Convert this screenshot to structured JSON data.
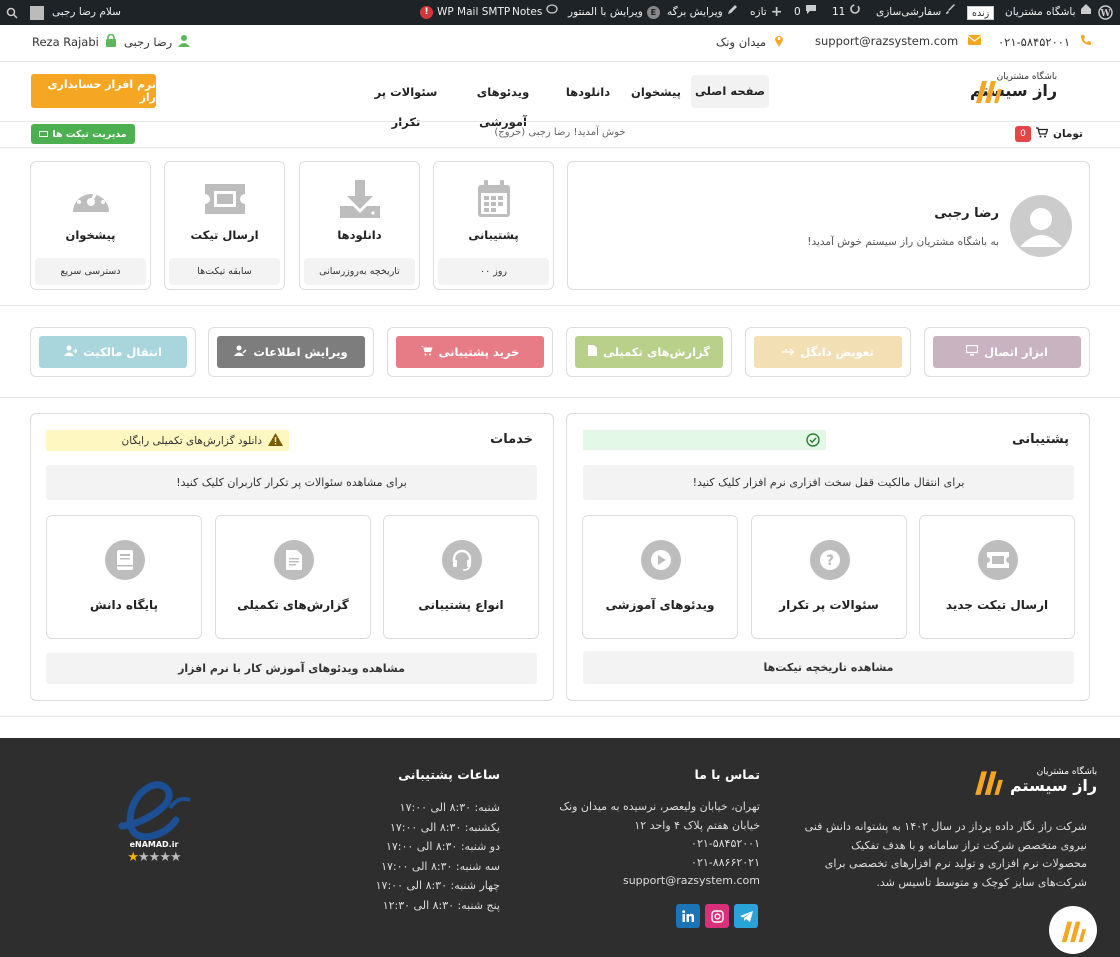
{
  "admin_bar": {
    "greeting": "سلام رضا رجبی",
    "site_name": "باشگاه مشتریان",
    "live_badge": "زنده",
    "customize": "سفارشی‌سازی",
    "updates_count": "11",
    "comments_count": "0",
    "new_label": "تازه",
    "edit_page": "ویرایش برگه",
    "edit_elementor": "ویرایش با المنتور",
    "notes": "Notes",
    "wp_mail_smtp": "WP Mail SMTP"
  },
  "top_info": {
    "phone": "۰۲۱-۵۸۴۵۲۰۰۱",
    "email": "support@razsystem.com",
    "location": "میدان ونک",
    "user_fa": "رضا رجبی",
    "user_en": "Reza Rajabi"
  },
  "brand": {
    "subtitle": "باشگاه مشتریان",
    "name": "راز سیستم"
  },
  "nav": {
    "items": [
      "صفحه اصلی",
      "پیشخوان",
      "دانلودها",
      "ویدئوهای آموزشی",
      "سئوالات پر تکرار"
    ],
    "cta": "نرم افزار حسابداری راز"
  },
  "subbar": {
    "cart_count": "0",
    "currency": "تومان",
    "welcome": "خوش آمدید! رضا رجبی (خروج)",
    "tickets_btn": "مدیریت تیکت ها"
  },
  "profile": {
    "name": "رضا رجبی",
    "message": "به باشگاه مشتریان راز سیستم خوش آمدید!"
  },
  "tiles": [
    {
      "title": "پشتیبانی",
      "sub": "۰۰ روز",
      "icon": "calendar-icon"
    },
    {
      "title": "دانلودها",
      "sub": "تاریخچه به‌روزرسانی",
      "icon": "download-icon"
    },
    {
      "title": "ارسال تیکت",
      "sub": "سابقه تیکت‌ها",
      "icon": "ticket-icon"
    },
    {
      "title": "پیشخوان",
      "sub": "دسترسی سریع",
      "icon": "dashboard-icon"
    }
  ],
  "quick_buttons": [
    {
      "label": "ابزار اتصال",
      "color": "#c9b3c0",
      "icon": "monitor-icon"
    },
    {
      "label": "تعویض دانگل",
      "color": "#f3dfb4",
      "icon": "usb-icon"
    },
    {
      "label": "گزارش‌های تکمیلی",
      "color": "#b9d08a",
      "icon": "file-icon"
    },
    {
      "label": "خرید پشتیبانی",
      "color": "#e87c86",
      "icon": "cart-icon"
    },
    {
      "label": "ویرایش اطلاعات",
      "color": "#7d7d7d",
      "icon": "user-edit-icon"
    },
    {
      "label": "انتقال مالکیت",
      "color": "#a9d6dc",
      "icon": "user-transfer-icon"
    }
  ],
  "support_panel": {
    "title": "پشتیبانی",
    "strip": "برای انتقال مالکیت قفل سخت افزاری نرم افزار کلیک کنید!",
    "cards": [
      {
        "label": "ارسال تیکت جدید",
        "icon": "ticket-icon"
      },
      {
        "label": "سئوالات پر تکرار",
        "icon": "question-icon"
      },
      {
        "label": "ویدئوهای آموزشی",
        "icon": "play-icon"
      }
    ],
    "footer": "مشاهده تاریخچه تیکت‌ها"
  },
  "services_panel": {
    "title": "خدمات",
    "notice": "دانلود گزارش‌های تکمیلی رایگان",
    "strip": "برای مشاهده سئوالات پر تکرار کاربران کلیک کنید!",
    "cards": [
      {
        "label": "انواع پشتیبانی",
        "icon": "headset-icon"
      },
      {
        "label": "گزارش‌های تکمیلی",
        "icon": "document-icon"
      },
      {
        "label": "پایگاه دانش",
        "icon": "book-icon"
      }
    ],
    "footer": "مشاهده ویدئوهای آموزش کار با نرم افزار"
  },
  "footer": {
    "brand_sub": "باشگاه مشتریان",
    "brand_name": "راز سیستم",
    "about": [
      "شرکت راز نگار داده پرداز در سال ۱۴۰۲ به پشتوانه دانش فنی",
      "نیروی متخصص شرکت تراز سامانه و با هدف تفکیک",
      "محصولات نرم افزاری و تولید نرم افزارهای تخصصی برای",
      "شرکت‌های سایز کوچک و متوسط تاسیس شد."
    ],
    "contact_title": "تماس با ما",
    "contact_lines": [
      "تهران، خیابان ولیعصر، نرسیده به میدان ونک",
      "خیابان هفتم پلاک ۴ واحد ۱۲",
      "۰۲۱-۵۸۴۵۲۰۰۱",
      "۰۲۱-۸۸۶۶۲۰۲۱",
      "support@razsystem.com"
    ],
    "hours_title": "ساعات پشتیبانی",
    "hours": [
      "شنبه: ۸:۳۰ الی ۱۷:۰۰",
      "یکشنبه: ۸:۳۰ الی ۱۷:۰۰",
      "دو شنبه: ۸:۳۰ الی ۱۷:۰۰",
      "سه شنبه: ۸:۳۰ الی ۱۷:۰۰",
      "چهار شنبه: ۸:۳۰ الی ۱۷:۰۰",
      "پنج شنبه: ۸:۳۰ الی ۱۲:۳۰"
    ],
    "enamad_label": "eNAMAD.ir",
    "enamad_rating": 1,
    "socials": [
      "telegram-icon",
      "instagram-icon",
      "linkedin-icon"
    ]
  },
  "colors": {
    "brand_orange": "#f5a623",
    "dark": "#1d2327",
    "footer_bg": "#2e2e2e",
    "green": "#4caf50",
    "cart_red": "#e64545"
  }
}
